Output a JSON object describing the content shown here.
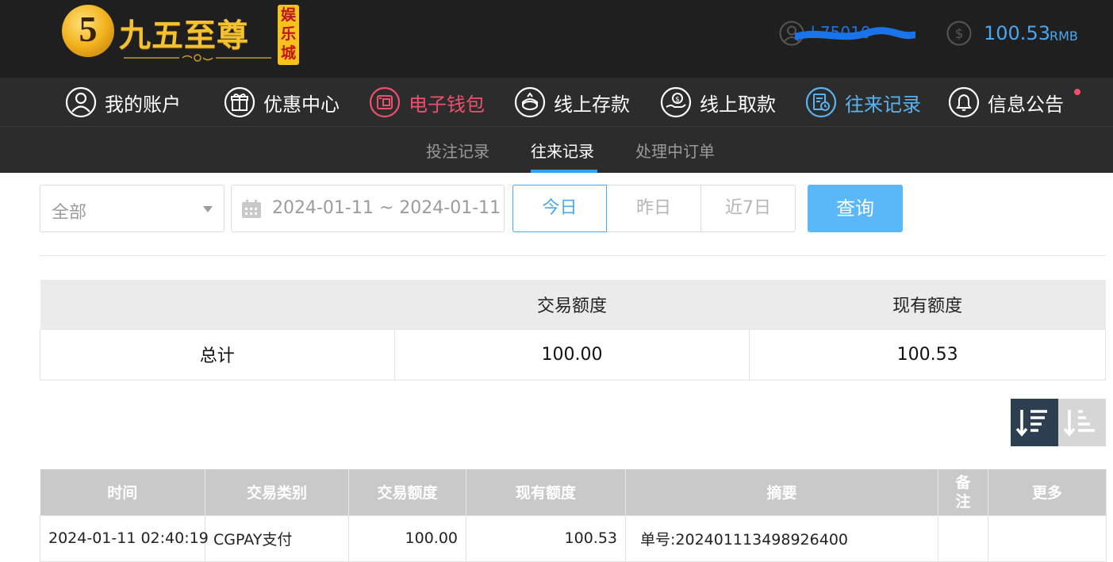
{
  "brand": {
    "coin_glyph": "5",
    "name": "九五至尊",
    "badge": [
      "娱",
      "乐",
      "城"
    ],
    "accent": "#f2c233"
  },
  "user": {
    "username_partial": "l 75010",
    "balance": "100.53",
    "currency": "RMB"
  },
  "main_nav": [
    {
      "label": "我的账户",
      "icon": "user-circle-icon"
    },
    {
      "label": "优惠中心",
      "icon": "gift-icon"
    },
    {
      "label": "电子钱包",
      "icon": "wallet-icon"
    },
    {
      "label": "线上存款",
      "icon": "deposit-icon"
    },
    {
      "label": "线上取款",
      "icon": "withdraw-icon"
    },
    {
      "label": "往来记录",
      "icon": "records-icon"
    },
    {
      "label": "信息公告",
      "icon": "bell-icon"
    }
  ],
  "sub_nav": [
    {
      "label": "投注记录",
      "active": false
    },
    {
      "label": "往来记录",
      "active": true
    },
    {
      "label": "处理中订单",
      "active": false
    }
  ],
  "filters": {
    "type_selected": "全部",
    "date_range": "2024-01-11 ~ 2024-01-11",
    "quick": [
      "今日",
      "昨日",
      "近7日"
    ],
    "quick_active": "今日",
    "search_label": "查询"
  },
  "summary": {
    "headers": [
      "",
      "交易额度",
      "现有额度"
    ],
    "row": [
      "总计",
      "100.00",
      "100.53"
    ]
  },
  "sort": {
    "active": "desc"
  },
  "details": {
    "headers": [
      "时间",
      "交易类别",
      "交易额度",
      "现有额度",
      "摘要",
      "备\n注",
      "更多"
    ],
    "rows": [
      [
        "2024-01-11 02:40:19",
        "CGPAY支付",
        "100.00",
        "100.53",
        "单号:202401113498926400",
        "",
        ""
      ]
    ]
  },
  "colors": {
    "header_bg": "#1f1f1f",
    "nav_bg": "#2c2c2c",
    "wallet_red": "#f0506e",
    "active_blue": "#58b4f2",
    "search_button": "#5bb8f8",
    "sort_active": "#2c3e50"
  }
}
